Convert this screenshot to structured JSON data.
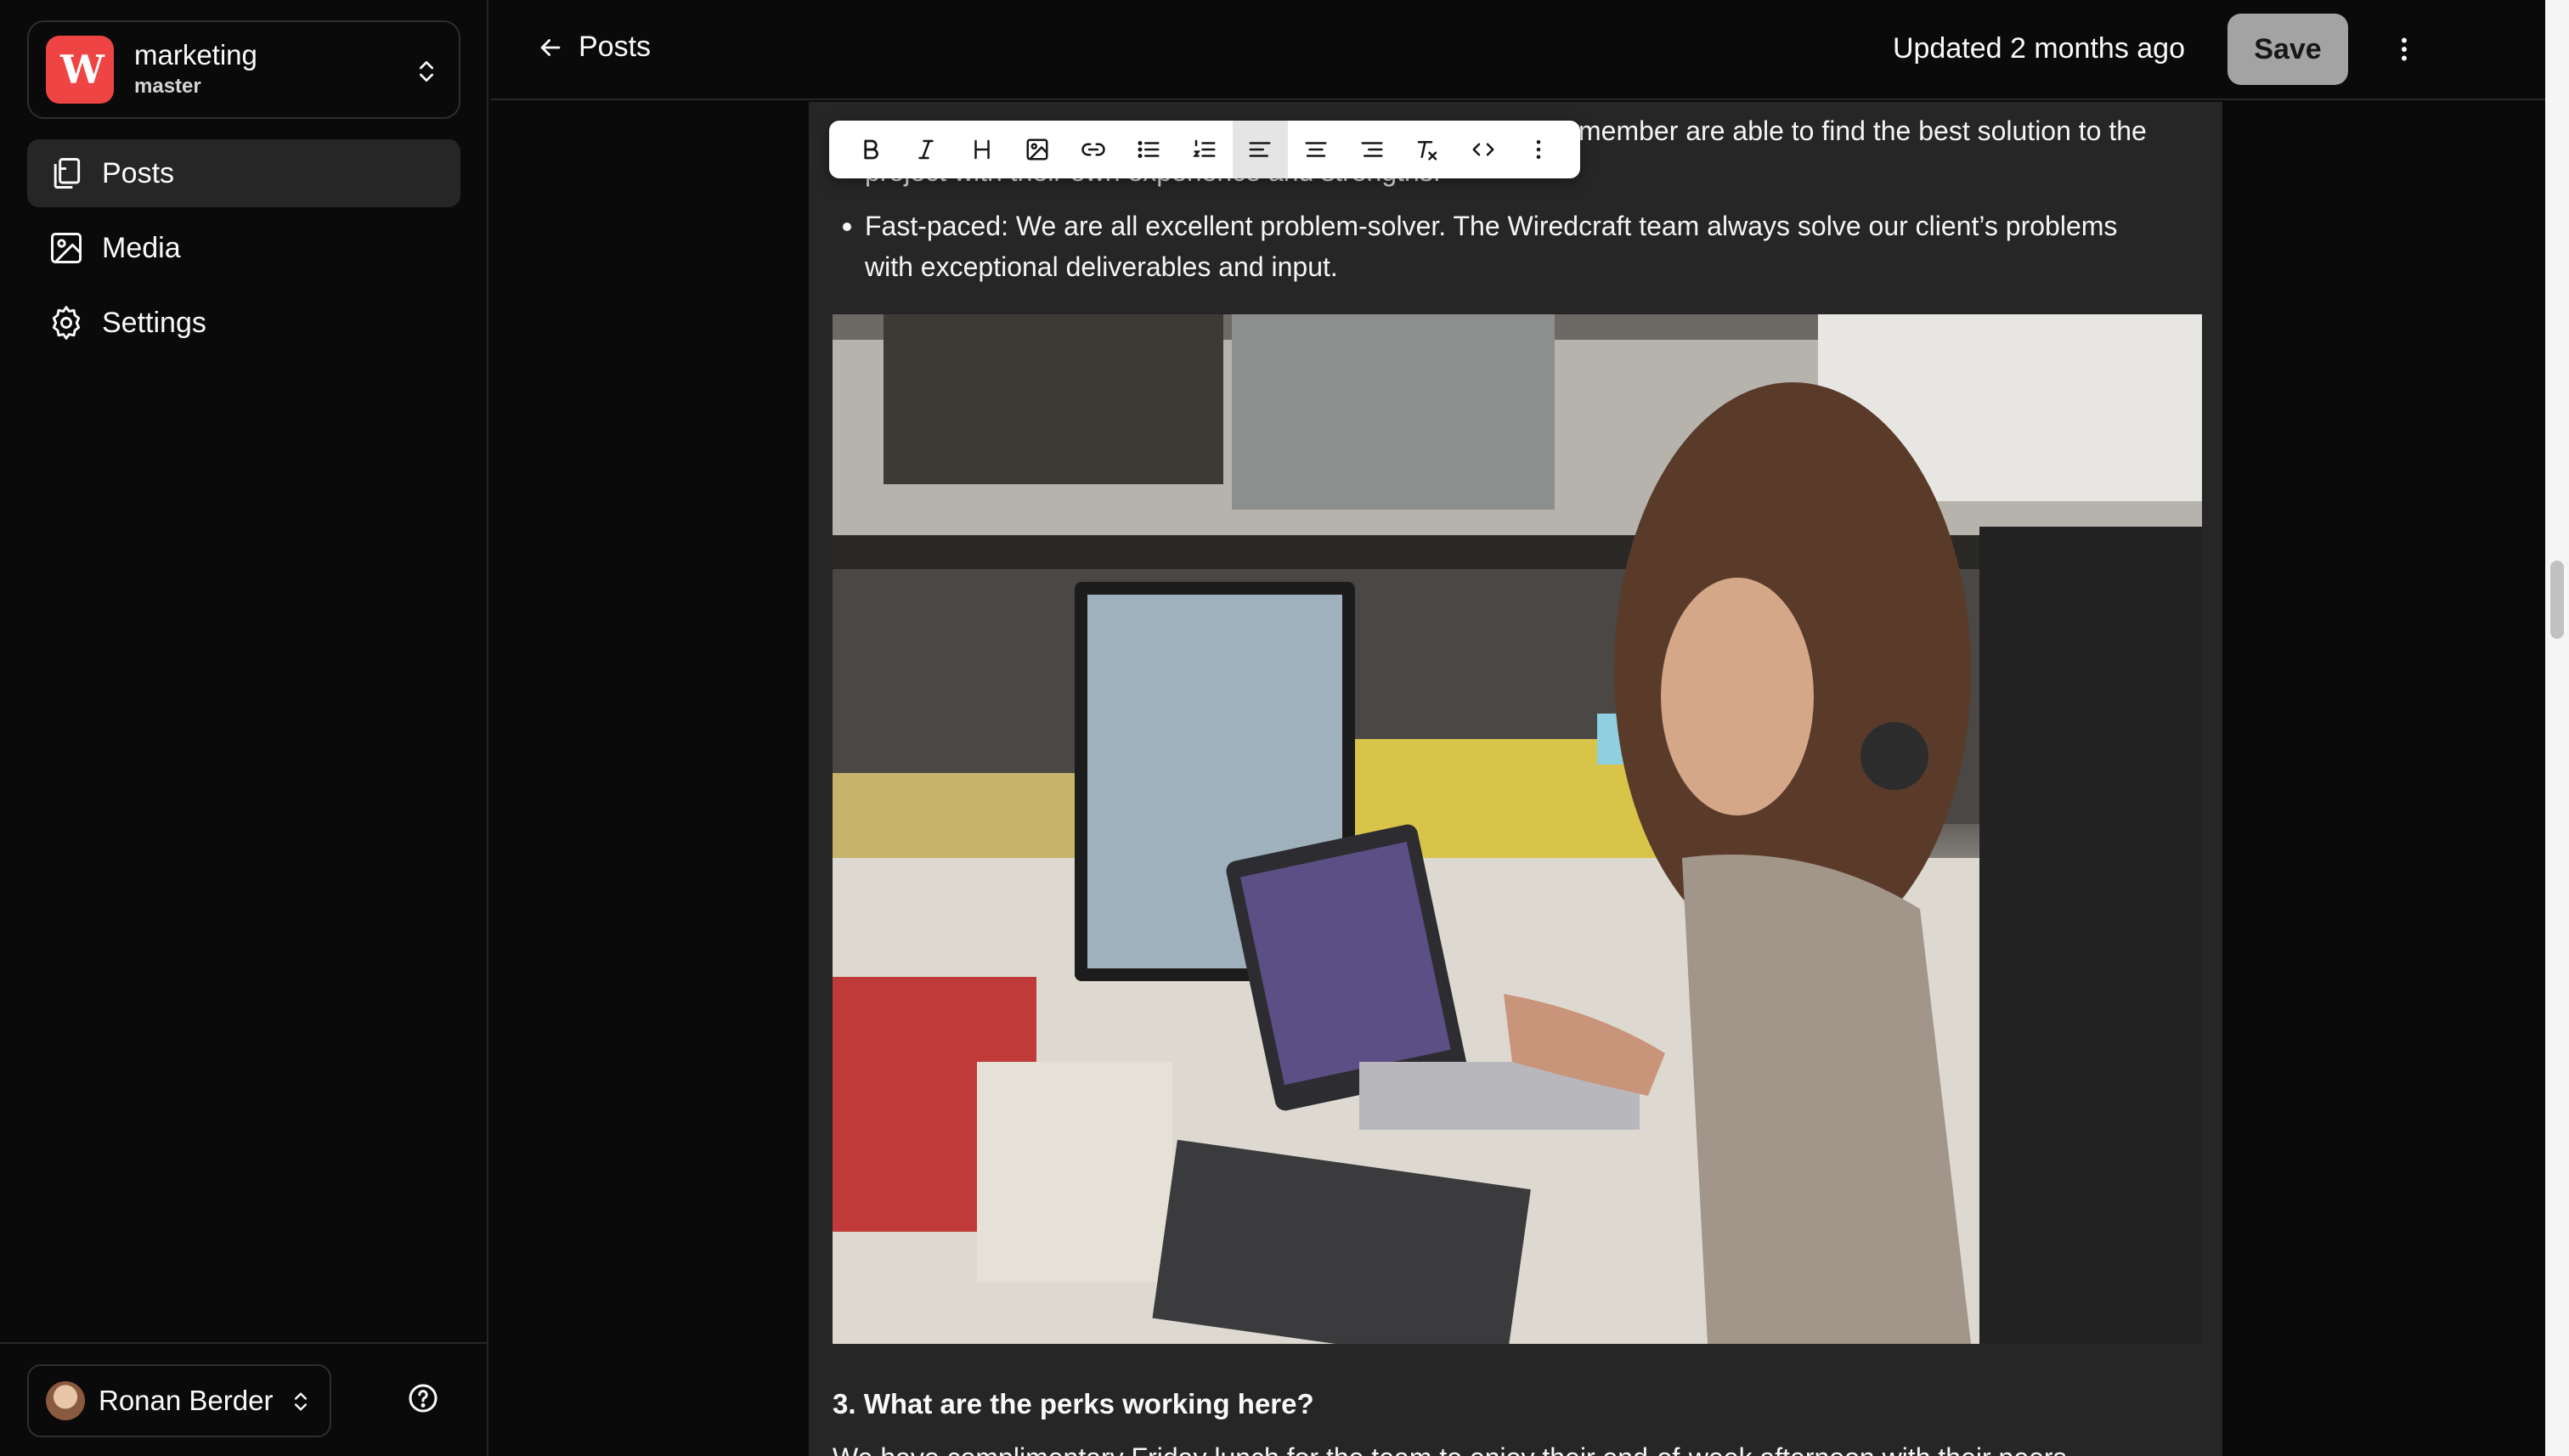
{
  "sidebar": {
    "repo": {
      "name": "marketing",
      "branch": "master",
      "logo_text": "W"
    },
    "nav": [
      {
        "label": "Posts",
        "icon": "posts-icon",
        "active": true
      },
      {
        "label": "Media",
        "icon": "image-icon",
        "active": false
      },
      {
        "label": "Settings",
        "icon": "gear-icon",
        "active": false
      }
    ],
    "user": {
      "name": "Ronan Berder"
    }
  },
  "header": {
    "back_label": "Posts",
    "updated": "Updated 2 months ago",
    "save_label": "Save"
  },
  "editor": {
    "partial_line_1": "member are able to find the best solution to the",
    "partial_line_2": "project with their own experience and strengths.",
    "bullet_fast_paced": "Fast-paced: We are all excellent problem-solver. The Wiredcraft team always solve our client’s problems with exceptional deliverables and input.",
    "heading": "3. What are the perks working here?",
    "partial_paragraph": "We have complimentary Friday lunch for the team to enjoy their end-of-week afternoon with their peers."
  },
  "toolbar": {
    "buttons": [
      "bold-icon",
      "italic-icon",
      "heading-icon",
      "image-icon",
      "link-icon",
      "bullet-list-icon",
      "ordered-list-icon",
      "align-left-icon",
      "align-center-icon",
      "align-right-icon",
      "clear-format-icon",
      "code-icon",
      "more-vertical-icon"
    ],
    "active": "align-left-icon"
  },
  "colors": {
    "background": "#0a0a0a",
    "panel": "#262626",
    "brand": "#ef4444",
    "save_button": "#a3a3a3"
  }
}
